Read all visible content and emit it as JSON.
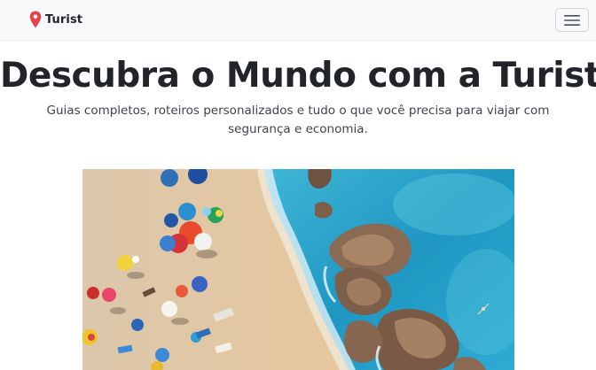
{
  "navbar": {
    "brand_name": "Turist",
    "brand_icon": "map-pin-icon",
    "brand_color": "#e8414b",
    "toggler_icon": "hamburger-menu-icon"
  },
  "hero": {
    "title": "Descubra o Mundo com a Turist",
    "subtitle": "Guias completos, roteiros personalizados e tudo o que você precisa para viajar com segurança e economia."
  },
  "colors": {
    "navbar_bg": "#f8f9fa",
    "text": "#212529",
    "sea": "#2a9fc4",
    "sand": "#e2c8a6"
  }
}
